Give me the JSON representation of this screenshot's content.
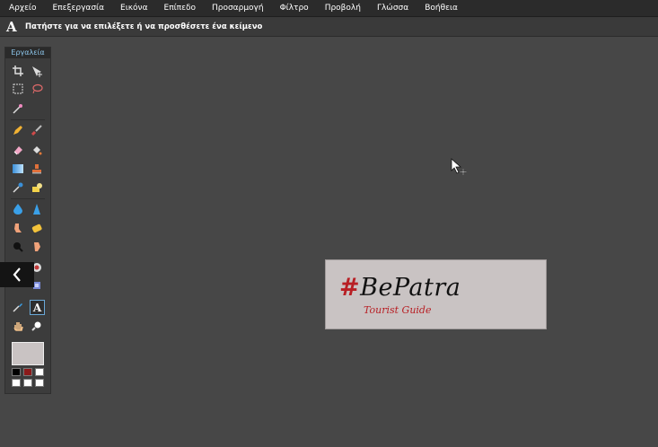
{
  "menubar": {
    "items": [
      "Αρχείο",
      "Επεξεργασία",
      "Εικόνα",
      "Επίπεδο",
      "Προσαρμογή",
      "Φίλτρο",
      "Προβολή",
      "Γλώσσα",
      "Βοήθεια"
    ]
  },
  "options_bar": {
    "tool_glyph": "A",
    "hint": "Πατήστε για να επιλέξετε ή να προσθέσετε ένα κείμενο"
  },
  "tools_panel": {
    "title": "Εργαλεία",
    "active_tool": "text-tool",
    "foreground_color": "#c9c3c3",
    "palette": [
      "#000000",
      "#8b1a1a",
      "#ffffff",
      "#ffffff",
      "#ffffff",
      "#ffffff"
    ]
  },
  "canvas": {
    "background": "#474747",
    "image": {
      "background": "#c9c3c3",
      "hash": "#",
      "title": "BePatra",
      "subtitle": "Tourist Guide",
      "accent_color": "#b81f24"
    }
  }
}
